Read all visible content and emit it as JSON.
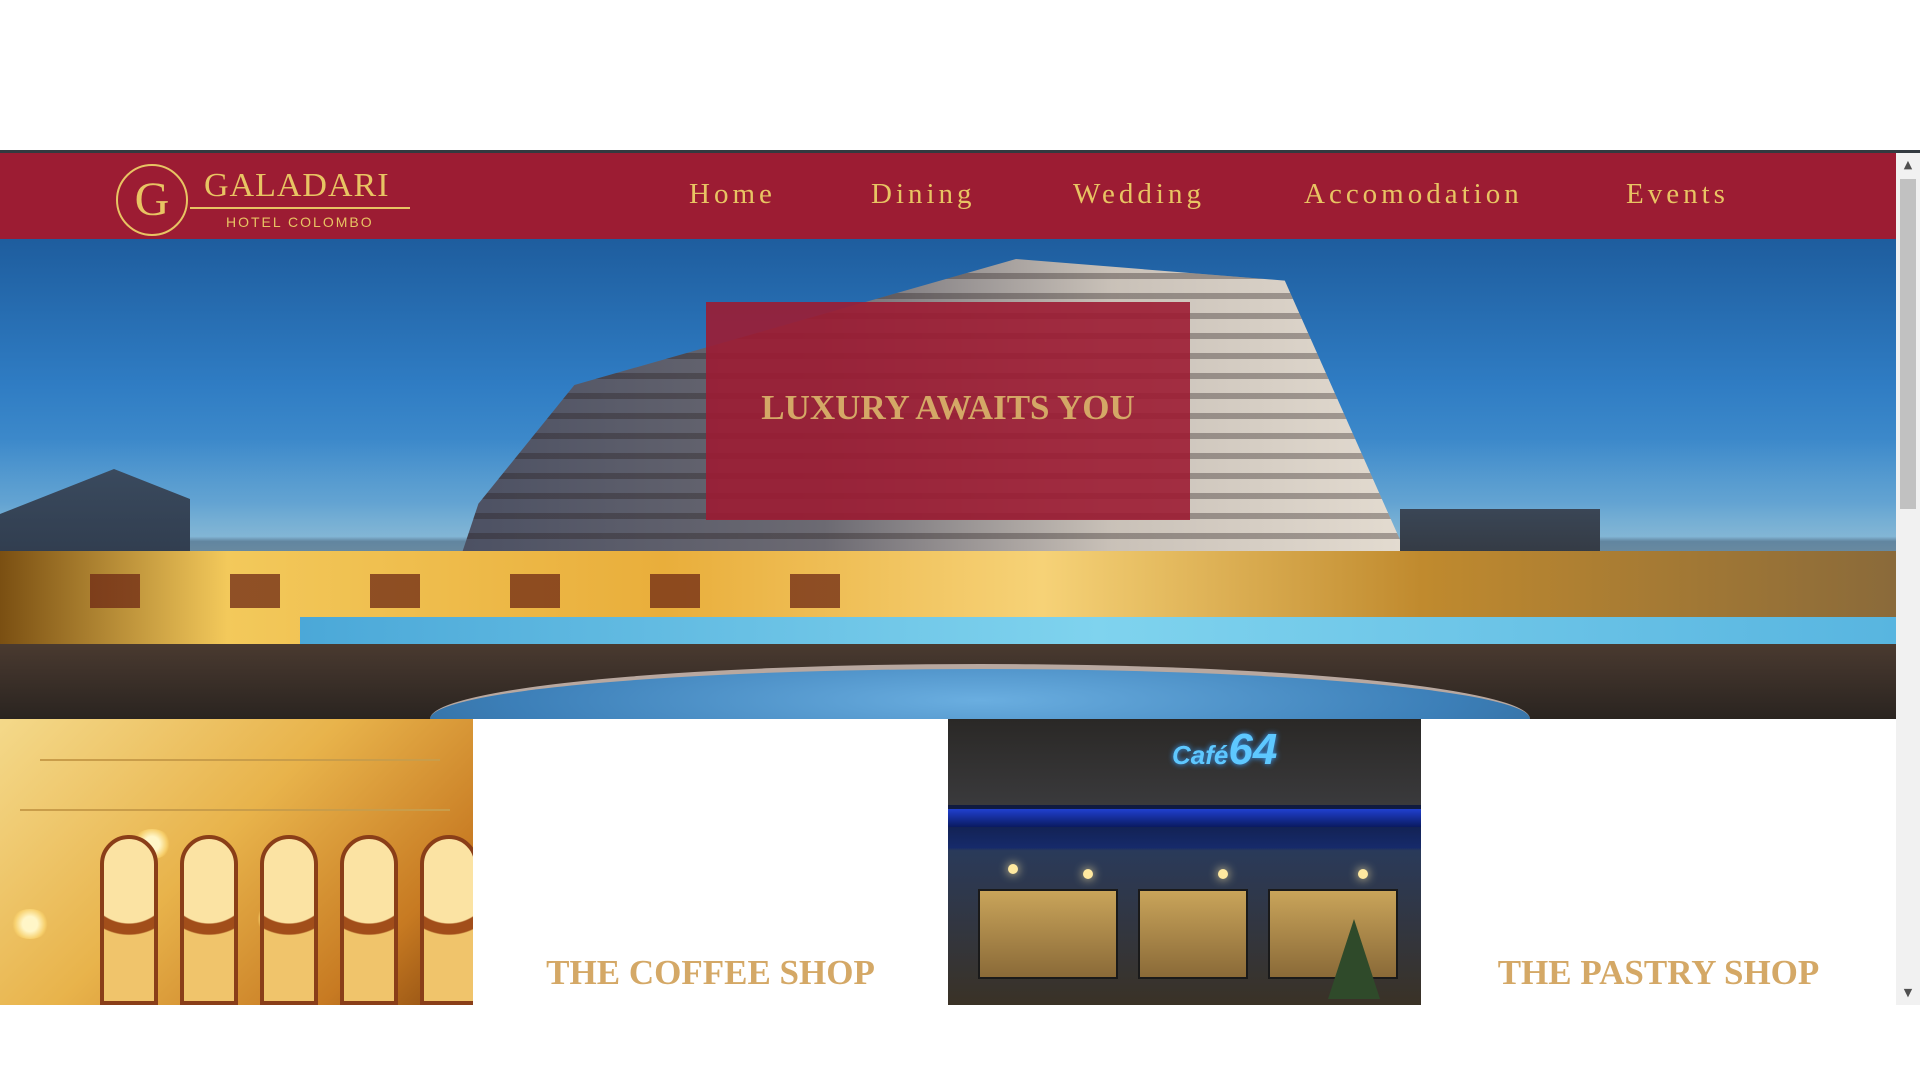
{
  "brand": {
    "initial": "G",
    "name": "GALADARI",
    "subtitle": "HOTEL COLOMBO",
    "color": "#9c1c33",
    "accent": "#e8c463",
    "gold_text": "#d4a866"
  },
  "nav": {
    "items": [
      {
        "label": "Home"
      },
      {
        "label": "Dining"
      },
      {
        "label": "Wedding"
      },
      {
        "label": "Accomodation"
      },
      {
        "label": "Events"
      }
    ]
  },
  "hero": {
    "title": "LUXURY AWAITS YOU"
  },
  "tiles": [
    {
      "caption": "THE COFFEE SHOP"
    },
    {
      "caption": "THE PASTRY SHOP"
    }
  ],
  "cafe_sign": {
    "word": "Café",
    "number": "64"
  },
  "scrollbar": {
    "up_icon": "▲",
    "down_icon": "▼"
  }
}
